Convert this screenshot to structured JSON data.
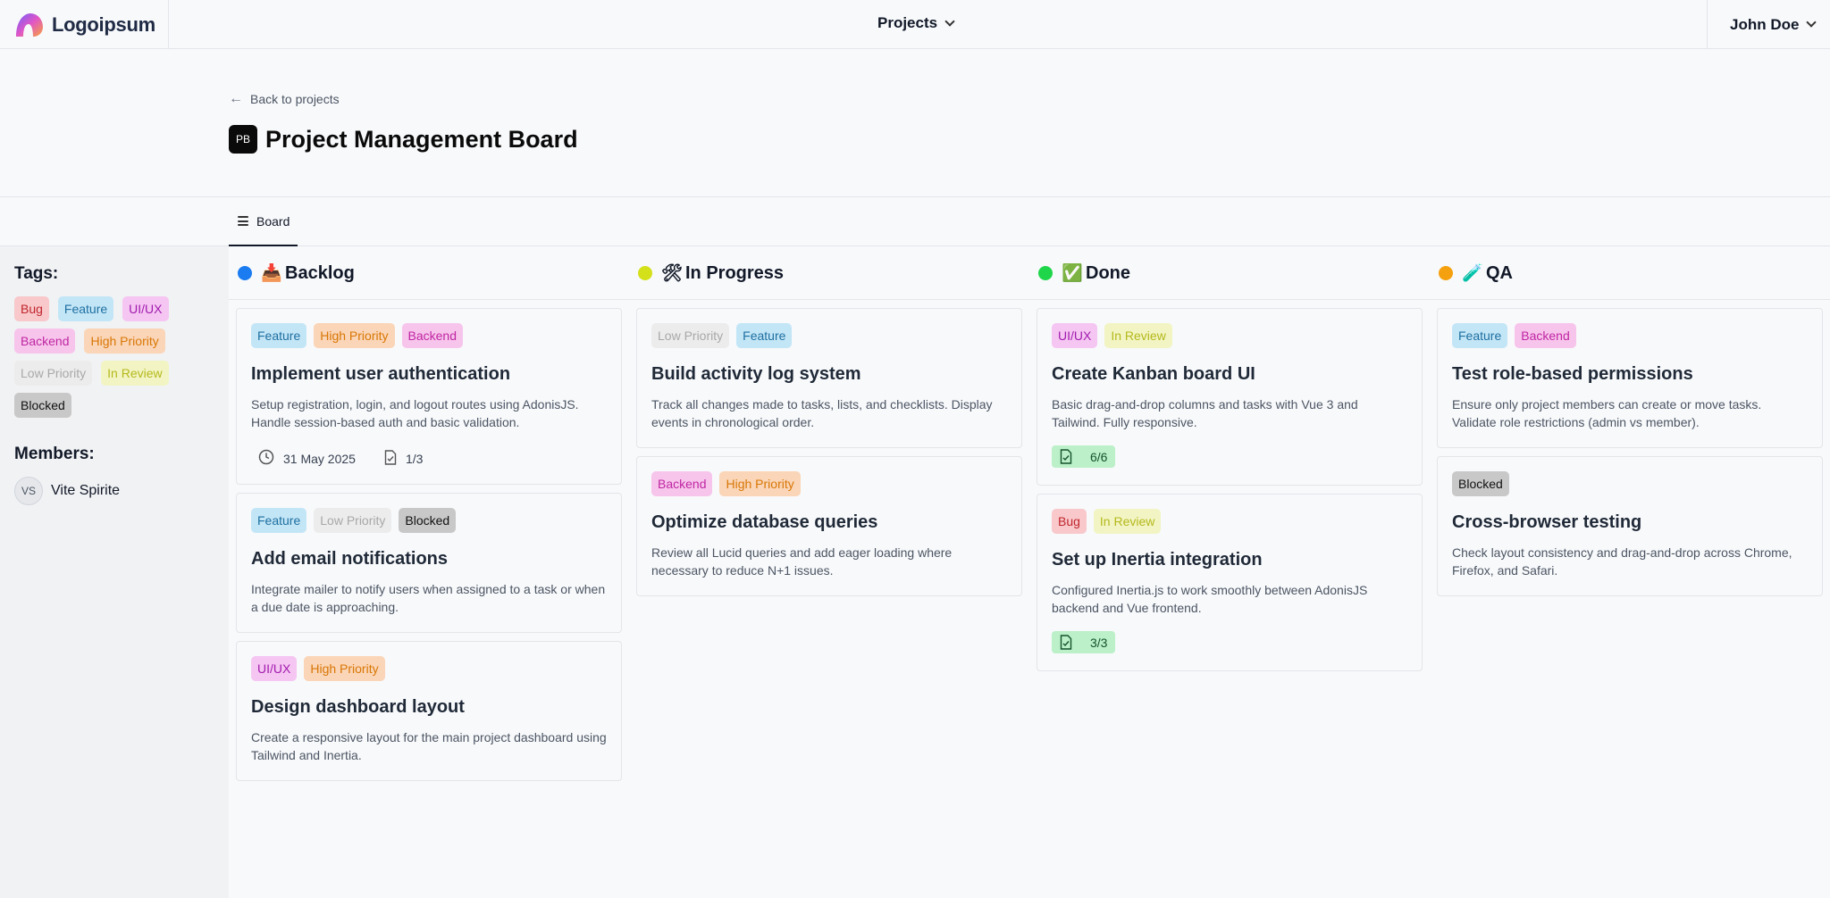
{
  "brand": {
    "logo_text": "Logoipsum"
  },
  "nav": {
    "projects_label": "Projects",
    "user_name": "John Doe"
  },
  "header": {
    "back_label": "Back to projects",
    "project_badge": "PB",
    "project_title": "Project Management Board"
  },
  "tabs": [
    {
      "label": "Board"
    }
  ],
  "sidebar": {
    "tags_title": "Tags:",
    "tags": [
      {
        "label": "Bug",
        "style": "t-bug"
      },
      {
        "label": "Feature",
        "style": "t-feature"
      },
      {
        "label": "UI/UX",
        "style": "t-uiux"
      },
      {
        "label": "Backend",
        "style": "t-backend"
      },
      {
        "label": "High Priority",
        "style": "t-high"
      },
      {
        "label": "Low Priority",
        "style": "t-low"
      },
      {
        "label": "In Review",
        "style": "t-review"
      },
      {
        "label": "Blocked",
        "style": "t-blocked"
      }
    ],
    "members_title": "Members:",
    "members": [
      {
        "initials": "VS",
        "name": "Vite Spirite"
      }
    ]
  },
  "columns": [
    {
      "title": "Backlog",
      "dot_color": "#1a7cf0",
      "emoji": "📥",
      "cards": [
        {
          "tags": [
            {
              "label": "Feature",
              "style": "t-feature"
            },
            {
              "label": "High Priority",
              "style": "t-high"
            },
            {
              "label": "Backend",
              "style": "t-backend"
            }
          ],
          "title": "Implement user authentication",
          "description": "Setup registration, login, and logout routes using AdonisJS. Handle session-based auth and basic validation.",
          "due_date": "31 May 2025",
          "checklist": "1/3"
        },
        {
          "tags": [
            {
              "label": "Feature",
              "style": "t-feature"
            },
            {
              "label": "Low Priority",
              "style": "t-low"
            },
            {
              "label": "Blocked",
              "style": "t-blocked"
            }
          ],
          "title": "Add email notifications",
          "description": "Integrate mailer to notify users when assigned to a task or when a due date is approaching."
        },
        {
          "tags": [
            {
              "label": "UI/UX",
              "style": "t-uiux"
            },
            {
              "label": "High Priority",
              "style": "t-high"
            }
          ],
          "title": "Design dashboard layout",
          "description": "Create a responsive layout for the main project dashboard using Tailwind and Inertia."
        }
      ]
    },
    {
      "title": "In Progress",
      "dot_color": "#d4e01a",
      "emoji": "🛠",
      "cards": [
        {
          "tags": [
            {
              "label": "Low Priority",
              "style": "t-low"
            },
            {
              "label": "Feature",
              "style": "t-feature"
            }
          ],
          "title": "Build activity log system",
          "description": "Track all changes made to tasks, lists, and checklists. Display events in chronological order."
        },
        {
          "tags": [
            {
              "label": "Backend",
              "style": "t-backend"
            },
            {
              "label": "High Priority",
              "style": "t-high"
            }
          ],
          "title": "Optimize database queries",
          "description": "Review all Lucid queries and add eager loading where necessary to reduce N+1 issues."
        }
      ]
    },
    {
      "title": "Done",
      "dot_color": "#1fd64a",
      "emoji": "✅",
      "cards": [
        {
          "tags": [
            {
              "label": "UI/UX",
              "style": "t-uiux"
            },
            {
              "label": "In Review",
              "style": "t-review"
            }
          ],
          "title": "Create Kanban board UI",
          "description": "Basic drag-and-drop columns and tasks with Vue 3 and Tailwind. Fully responsive.",
          "checklist_done": "6/6"
        },
        {
          "tags": [
            {
              "label": "Bug",
              "style": "t-bug"
            },
            {
              "label": "In Review",
              "style": "t-review"
            }
          ],
          "title": "Set up Inertia integration",
          "description": "Configured Inertia.js to work smoothly between AdonisJS backend and Vue frontend.",
          "checklist_done": "3/3"
        }
      ]
    },
    {
      "title": "QA",
      "dot_color": "#f5a10f",
      "emoji": "🧪",
      "cards": [
        {
          "tags": [
            {
              "label": "Feature",
              "style": "t-feature"
            },
            {
              "label": "Backend",
              "style": "t-backend"
            }
          ],
          "title": "Test role-based permissions",
          "description": "Ensure only project members can create or move tasks. Validate role restrictions (admin vs member)."
        },
        {
          "tags": [
            {
              "label": "Blocked",
              "style": "t-blocked"
            }
          ],
          "title": "Cross-browser testing",
          "description": "Check layout consistency and drag-and-drop across Chrome, Firefox, and Safari."
        }
      ]
    }
  ]
}
